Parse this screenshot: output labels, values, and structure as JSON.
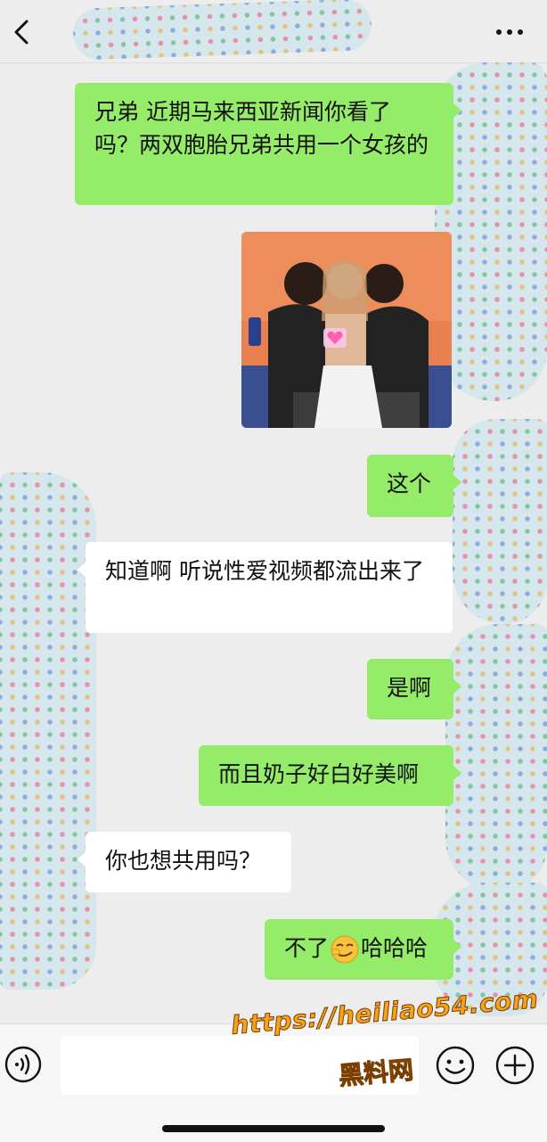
{
  "header": {
    "back_icon": "chevron-left-icon",
    "more_icon": "ellipsis-icon"
  },
  "messages": [
    {
      "side": "out",
      "type": "text",
      "text": "兄弟 近期马来西亚新闻你看了吗？两双胞胎兄弟共用一个女孩的"
    },
    {
      "side": "out",
      "type": "image",
      "sticker": "heart-pixel-icon"
    },
    {
      "side": "out",
      "type": "text",
      "text": "这个"
    },
    {
      "side": "in",
      "type": "text",
      "text": "知道啊 听说性爱视频都流出来了"
    },
    {
      "side": "out",
      "type": "text",
      "text": "是啊"
    },
    {
      "side": "out",
      "type": "text",
      "text": "而且奶子好白好美啊"
    },
    {
      "side": "in",
      "type": "text",
      "text": "你也想共用吗？"
    },
    {
      "side": "out",
      "type": "text",
      "text": "不了",
      "emoji": "smirk-emoji-icon",
      "text_after": "哈哈哈"
    }
  ],
  "input_bar": {
    "voice_icon": "voice-icon",
    "input_value": "",
    "emoji_icon": "smiley-icon",
    "plus_icon": "plus-circle-icon"
  },
  "watermark": {
    "url": "https://heiliao54.com",
    "name": "黑料网"
  },
  "colors": {
    "background": "#ededed",
    "outgoing_bubble": "#95ec69",
    "incoming_bubble": "#ffffff",
    "watermark": "#f7a21b"
  }
}
